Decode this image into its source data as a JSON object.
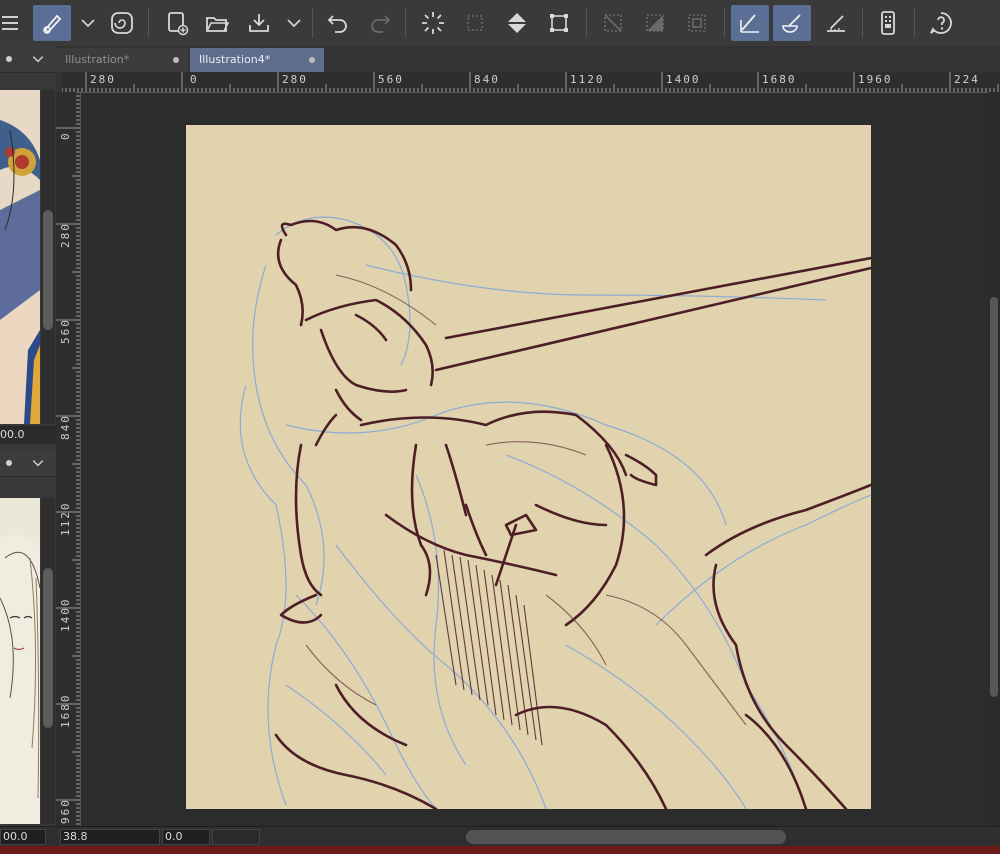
{
  "tabs": [
    {
      "label": "Illustration*",
      "active": false
    },
    {
      "label": "Illustration4*",
      "active": true
    }
  ],
  "rulers": {
    "horizontal": [
      "280",
      "0",
      "280",
      "560",
      "840",
      "1120",
      "1400",
      "1680",
      "1960",
      "224"
    ],
    "vertical": [
      "0",
      "280",
      "560",
      "840",
      "1120",
      "1400",
      "1680",
      "960"
    ]
  },
  "left_panel": {
    "top_value": "00.0",
    "bottom_value": "00.0"
  },
  "status": {
    "zoom": "38.8",
    "rotation": "0.0"
  },
  "colors": {
    "paper": "#e0d3ae",
    "sketch_dark": "#4e1e26",
    "sketch_blue": "#7ea5dc",
    "accent": "#5b6f96"
  },
  "icons": [
    "menu-icon",
    "pen-tool-icon",
    "chevron-down-icon",
    "spiral-icon",
    "new-canvas-icon",
    "open-folder-icon",
    "save-icon",
    "chevron-down-icon",
    "undo-icon",
    "redo-icon",
    "loading-spinner-icon",
    "selection-icon",
    "fill-icon",
    "transform-icon",
    "clear-selection-icon",
    "invert-selection-icon",
    "crop-selection-icon",
    "pen-pressure-icon",
    "brush-icon",
    "ruler-snap-icon",
    "device-icon",
    "help-icon"
  ]
}
